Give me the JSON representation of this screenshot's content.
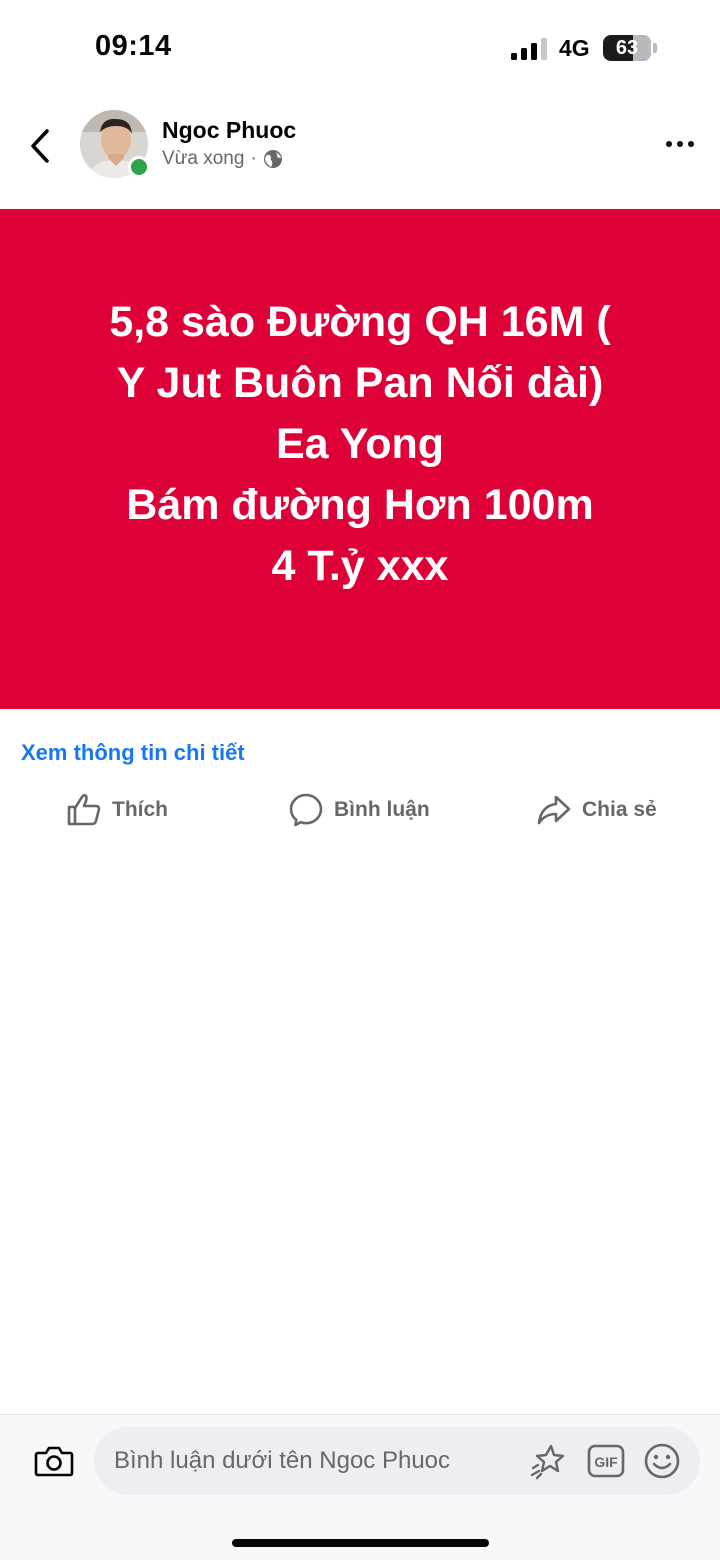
{
  "status_bar": {
    "time": "09:14",
    "network": "4G",
    "battery": "63",
    "battery_level": 0.63
  },
  "post": {
    "author": "Ngoc Phuoc",
    "time": "Vừa xong",
    "separator": "·",
    "audience_icon": "globe-icon",
    "banner_color": "#dd0138",
    "banner_lines": [
      "5,8 sào Đường QH 16M (",
      "Y Jut Buôn Pan Nối dài)",
      "Ea Yong",
      "Bám đường Hơn 100m",
      "4 T.ỷ xxx"
    ],
    "details_link": "Xem thông tin chi tiết"
  },
  "actions": {
    "like": "Thích",
    "comment": "Bình luận",
    "share": "Chia sẻ"
  },
  "comment_bar": {
    "placeholder": "Bình luận dưới tên Ngoc Phuoc",
    "gif_label": "GIF"
  },
  "colors": {
    "link": "#1877f2",
    "online": "#31a24c",
    "secondary_text": "#65676b"
  }
}
